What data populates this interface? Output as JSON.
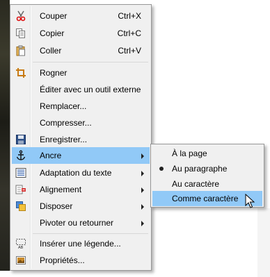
{
  "context_menu": {
    "items": [
      {
        "label": "Couper",
        "shortcut": "Ctrl+X",
        "icon": "scissors-icon"
      },
      {
        "label": "Copier",
        "shortcut": "Ctrl+C",
        "icon": "copy-icon"
      },
      {
        "label": "Coller",
        "shortcut": "Ctrl+V",
        "icon": "paste-icon"
      },
      {
        "label": "Rogner",
        "icon": "crop-icon"
      },
      {
        "label": "Éditer avec un outil externe"
      },
      {
        "label": "Remplacer..."
      },
      {
        "label": "Compresser..."
      },
      {
        "label": "Enregistrer...",
        "icon": "save-icon"
      },
      {
        "label": "Ancre",
        "icon": "anchor-icon",
        "submenu": true,
        "selected": true
      },
      {
        "label": "Adaptation du texte",
        "icon": "text-wrap-icon",
        "submenu": true
      },
      {
        "label": "Alignement",
        "icon": "align-icon",
        "submenu": true
      },
      {
        "label": "Disposer",
        "icon": "arrange-icon",
        "submenu": true
      },
      {
        "label": "Pivoter ou retourner",
        "submenu": true
      },
      {
        "label": "Insérer une légende...",
        "icon": "caption-icon"
      },
      {
        "label": "Propriétés...",
        "icon": "properties-icon"
      }
    ]
  },
  "anchor_submenu": {
    "items": [
      {
        "label": "À la page"
      },
      {
        "label": "Au paragraphe",
        "checked": true
      },
      {
        "label": "Au caractère"
      },
      {
        "label": "Comme caractère",
        "highlighted": true
      }
    ]
  },
  "colors": {
    "menu_background": "#f0f0f0",
    "highlight": "#91c9f7",
    "border": "#979797"
  }
}
